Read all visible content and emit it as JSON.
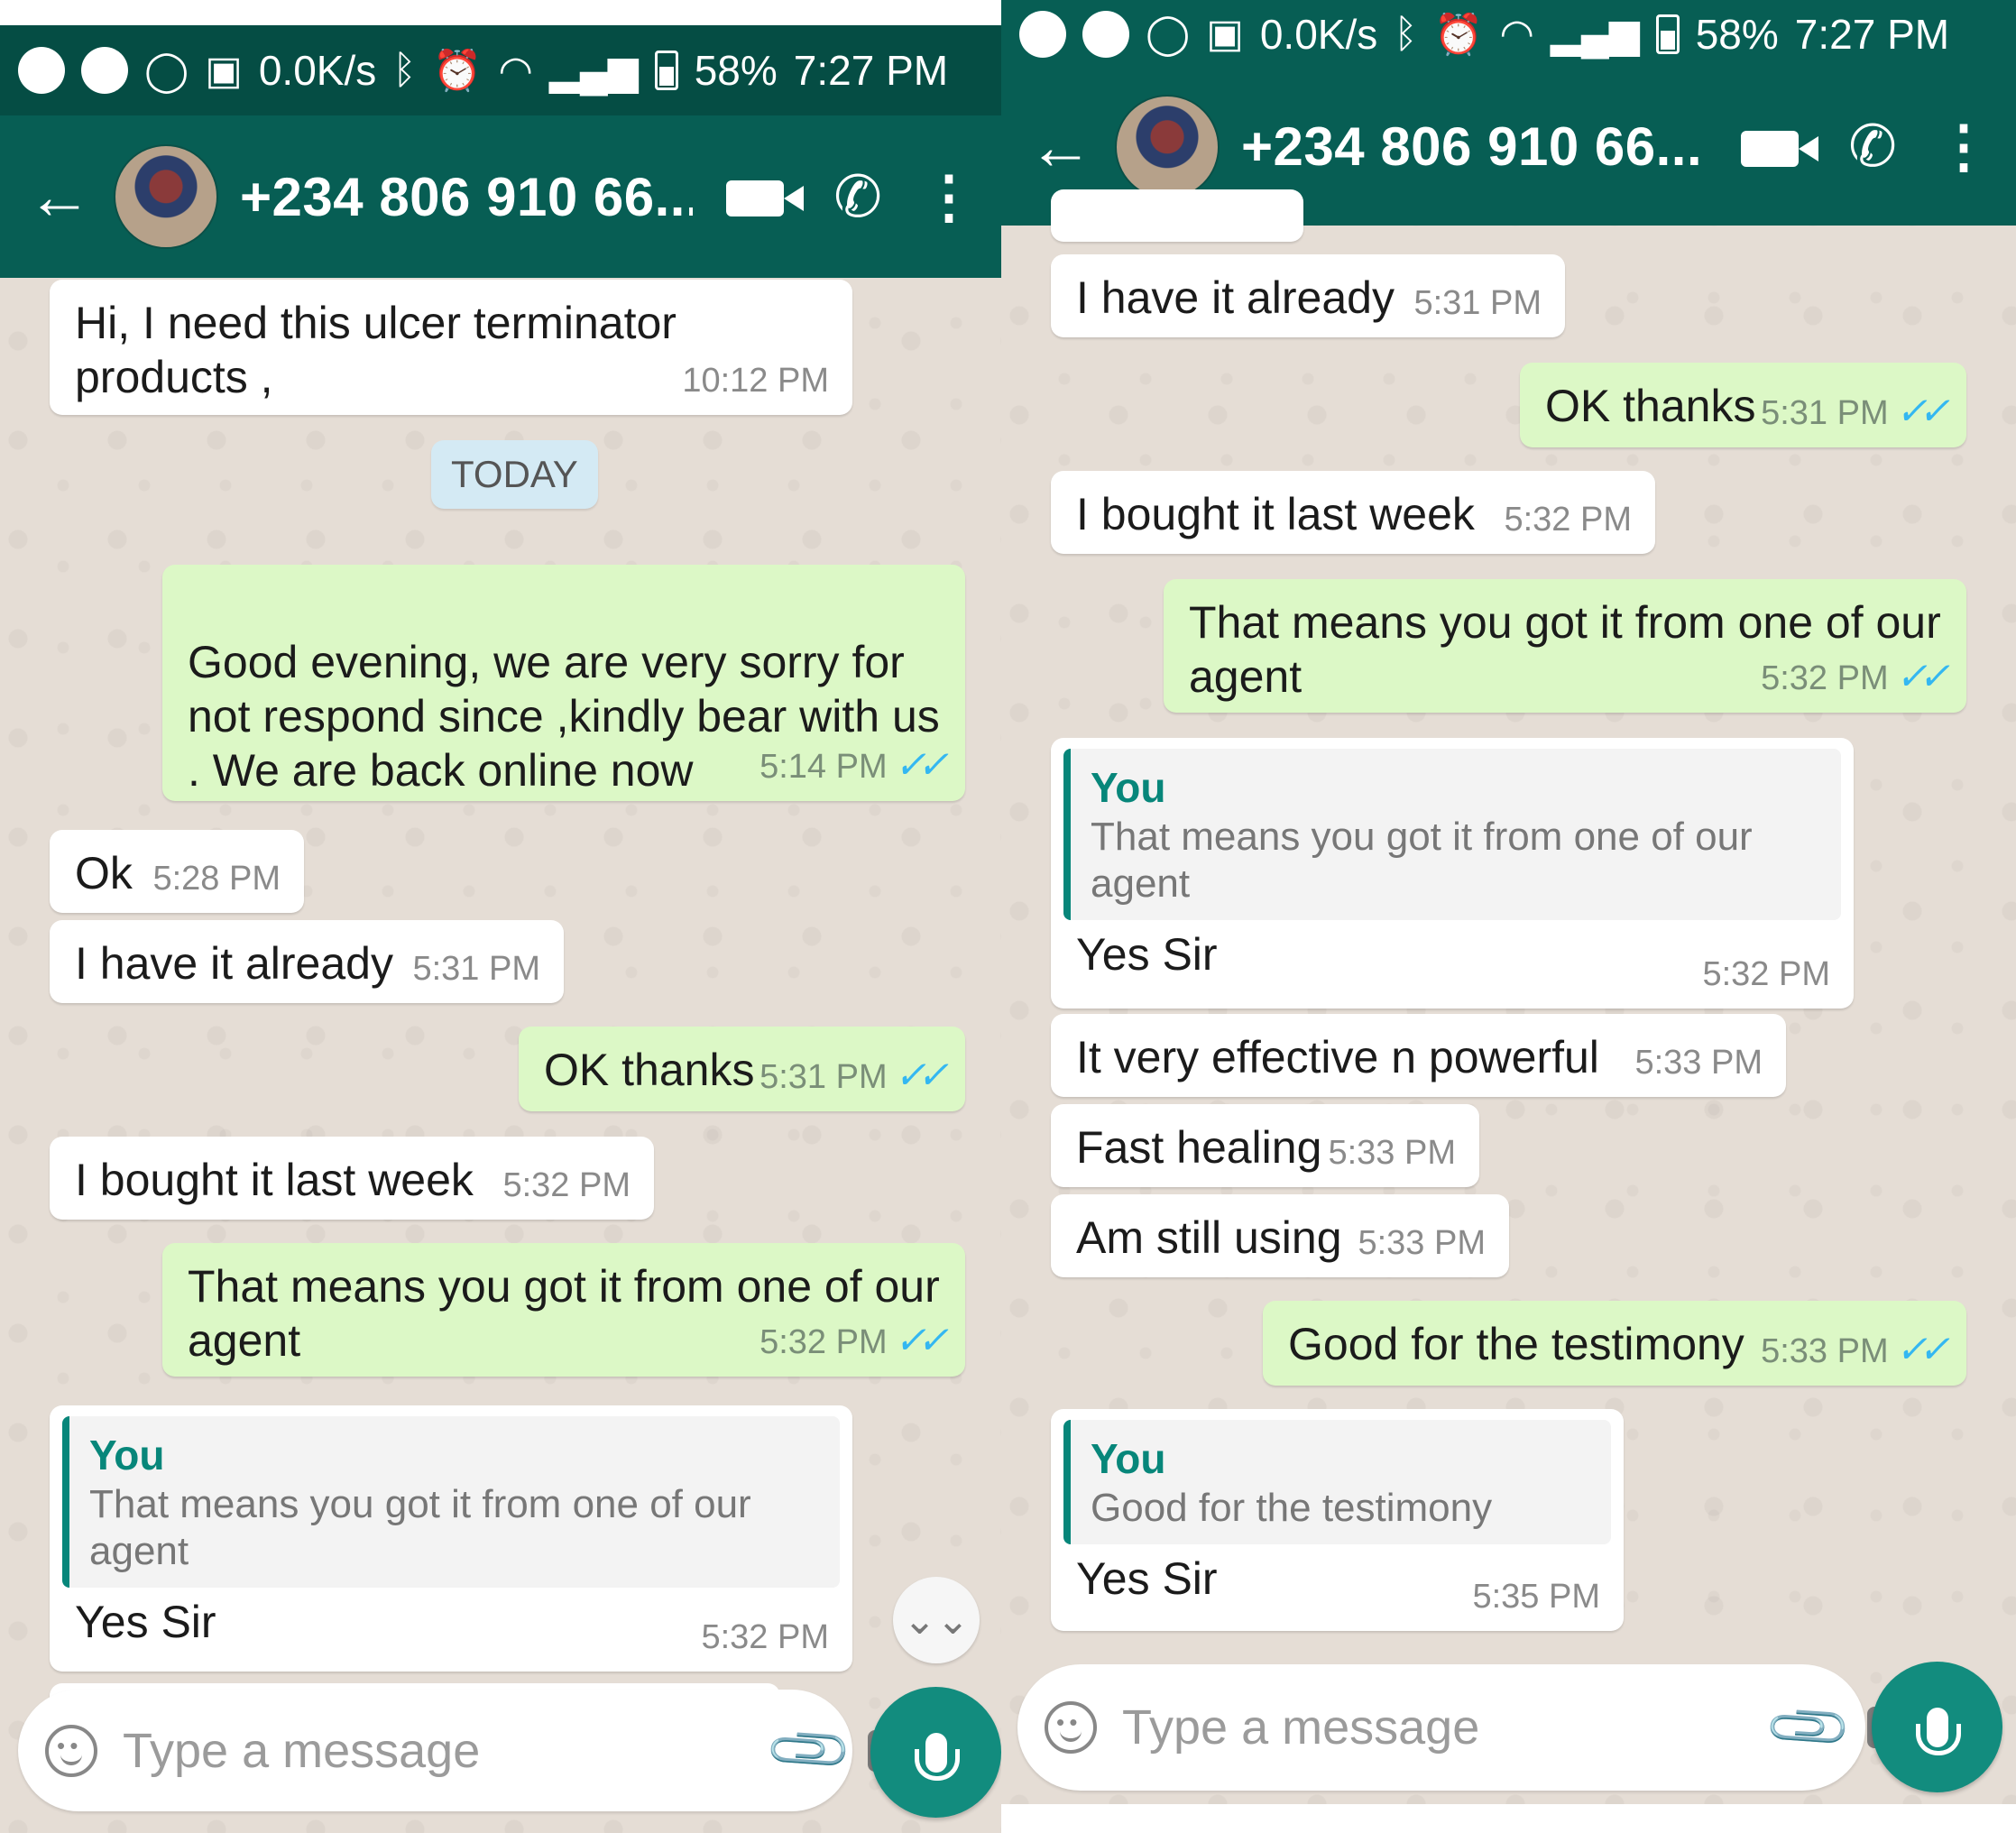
{
  "status_bar": {
    "net_speed": "0.0K/s",
    "battery": "58%",
    "time": "7:27 PM"
  },
  "header": {
    "contact": "+234 806 910 66..."
  },
  "left_panel": {
    "messages": [
      {
        "dir": "in",
        "text": "Hi, I need this ulcer terminator products ,",
        "time": "10:12 PM"
      },
      {
        "dir": "out",
        "text": "Good evening, we are very sorry for not respond since ,kindly bear with us\n. We are back online now",
        "time": "5:14 PM"
      },
      {
        "dir": "in",
        "text": "Ok",
        "time": "5:28 PM"
      },
      {
        "dir": "in",
        "text": "I have it already",
        "time": "5:31 PM"
      },
      {
        "dir": "out",
        "text": "OK thanks",
        "time": "5:31 PM"
      },
      {
        "dir": "in",
        "text": "I bought it last week",
        "time": "5:32 PM"
      },
      {
        "dir": "out",
        "text": "That means you got it from one of our agent",
        "time": "5:32 PM"
      },
      {
        "dir": "in",
        "quote_author": "You",
        "quote_text": "That means you got it from one of our agent",
        "text": "Yes Sir",
        "time": "5:32 PM"
      }
    ],
    "date_chip": "TODAY"
  },
  "right_panel": {
    "messages": [
      {
        "dir": "in",
        "text": "I have it already",
        "time": "5:31 PM"
      },
      {
        "dir": "out",
        "text": "OK thanks",
        "time": "5:31 PM"
      },
      {
        "dir": "in",
        "text": "I bought it last week",
        "time": "5:32 PM"
      },
      {
        "dir": "out",
        "text": "That means you got it from one of our agent",
        "time": "5:32 PM"
      },
      {
        "dir": "in",
        "quote_author": "You",
        "quote_text": "That means you got it from one of our agent",
        "text": "Yes Sir",
        "time": "5:32 PM"
      },
      {
        "dir": "in",
        "text": "It very effective n powerful",
        "time": "5:33 PM"
      },
      {
        "dir": "in",
        "text": "Fast healing",
        "time": "5:33 PM"
      },
      {
        "dir": "in",
        "text": "Am still using",
        "time": "5:33 PM"
      },
      {
        "dir": "out",
        "text": "Good for the testimony",
        "time": "5:33 PM"
      },
      {
        "dir": "in",
        "quote_author": "You",
        "quote_text": "Good for the testimony",
        "text": "Yes Sir",
        "time": "5:35 PM"
      }
    ]
  },
  "composer": {
    "placeholder": "Type a message"
  },
  "colors": {
    "header": "#075e54",
    "statusbar": "#054d44",
    "outgoing_bubble": "#dcf8c6",
    "incoming_bubble": "#ffffff",
    "wallpaper": "#e5ddd5",
    "read_ticks": "#34b7f1",
    "mic_button": "#128c7e"
  },
  "icons": [
    "back-arrow-icon",
    "video-call-icon",
    "voice-call-icon",
    "more-options-icon",
    "emoji-icon",
    "attach-icon",
    "camera-icon",
    "mic-icon",
    "whatsapp-icon",
    "gallery-icon",
    "bluetooth-icon",
    "alarm-icon",
    "wifi-icon",
    "signal-icon",
    "battery-icon",
    "scroll-down-icon"
  ]
}
